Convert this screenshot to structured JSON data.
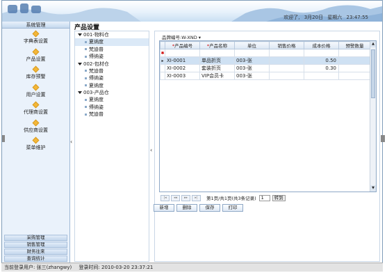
{
  "banner": {
    "date_label": "欢迎了,",
    "date": "3月20日",
    "weekday": "星期六",
    "time": "23:47:55"
  },
  "sidebar": {
    "title": "系统管理",
    "items": [
      {
        "label": "字典表设置"
      },
      {
        "label": "产品设置"
      },
      {
        "label": "库存预警"
      },
      {
        "label": "用户设置"
      },
      {
        "label": "代理商设置"
      },
      {
        "label": "供应商设置"
      },
      {
        "label": "菜单维护"
      }
    ],
    "bottom": [
      {
        "label": "采购管理"
      },
      {
        "label": "销售管理"
      },
      {
        "label": "财务往来"
      },
      {
        "label": "查询统计"
      }
    ]
  },
  "page": {
    "title": "产品设置"
  },
  "tree": [
    {
      "label": "001-物料仓",
      "children": [
        "夏纳度",
        "梵迪普",
        "傅纳姿"
      ]
    },
    {
      "label": "002-包材仓",
      "children": [
        "梵迪普",
        "傅纳姿",
        "夏纳度"
      ]
    },
    {
      "label": "003-产品仓",
      "children": [
        "夏纳度",
        "傅纳姿",
        "梵迪普"
      ]
    }
  ],
  "filter": {
    "label": "品牌编号:",
    "value": "W-XND"
  },
  "grid": {
    "columns": [
      "产品编号",
      "产品名称",
      "单位",
      "销售价格",
      "成本价格",
      "预警数量"
    ],
    "required": [
      true,
      true,
      false,
      false,
      false,
      false
    ],
    "rows": [
      {
        "cells": [
          "XI-0001",
          "单品折页",
          "003-张",
          "",
          "0.50",
          ""
        ],
        "selected": true
      },
      {
        "cells": [
          "XI-0002",
          "套装折页",
          "003-张",
          "",
          "0.30",
          ""
        ],
        "selected": false
      },
      {
        "cells": [
          "XI-0003",
          "VIP会员卡",
          "003-张",
          "",
          "",
          ""
        ],
        "selected": false
      }
    ],
    "row_marker": "▸",
    "new_marker": "✱"
  },
  "pager": {
    "info": "第1页/共1页(共3条记录)",
    "page": "1",
    "go_label": "转到"
  },
  "actions": {
    "add": "新增",
    "delete": "删除",
    "save": "保存",
    "print": "打印"
  },
  "status": {
    "user": "当前登录用户: 张三(zhangwy)",
    "login": "登录时间: 2010-03-20 23:37:21"
  }
}
